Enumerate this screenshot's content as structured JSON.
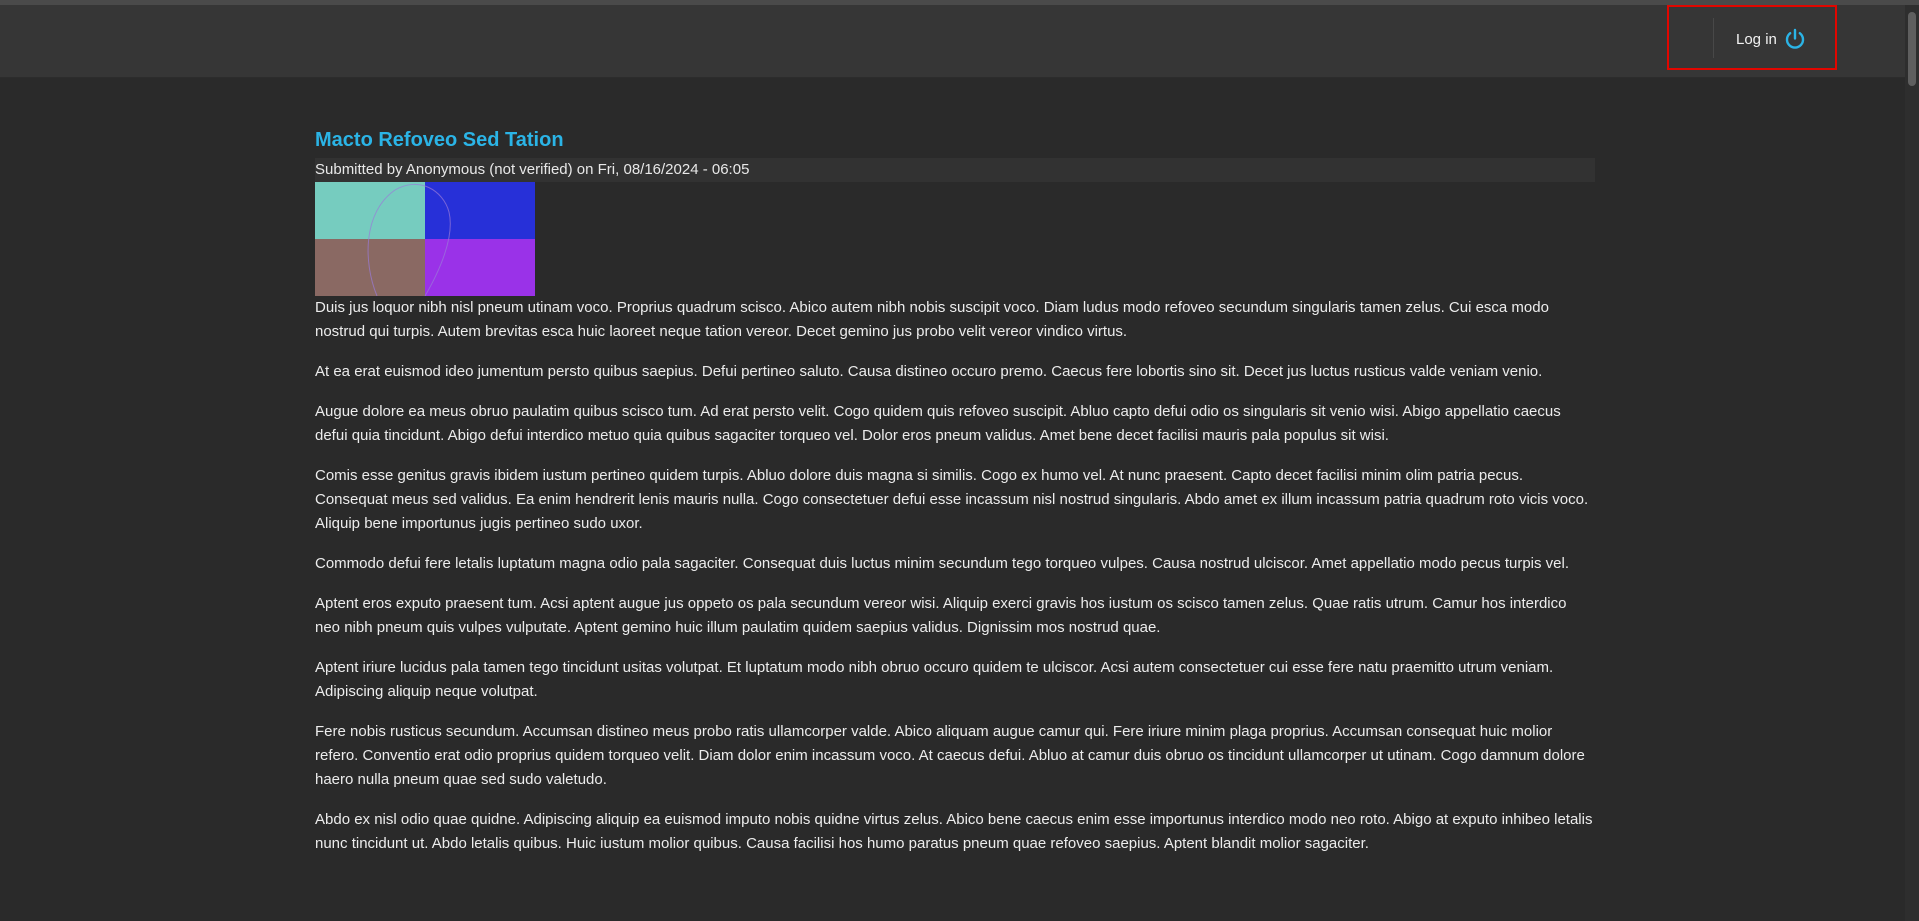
{
  "header": {
    "login_label": "Log in",
    "login_icon": "power-icon",
    "accent": "#2bb4e6",
    "highlight_color": "#e10600"
  },
  "article": {
    "title": "Macto Refoveo Sed Tation",
    "submitted": "Submitted by Anonymous (not verified) on Fri, 08/16/2024 - 06:05",
    "image_colors": [
      "#76ccbf",
      "#2730d8",
      "#8a6963",
      "#9a32e8"
    ],
    "paragraphs": [
      "Duis jus loquor nibh nisl pneum utinam voco. Proprius quadrum scisco. Abico autem nibh nobis suscipit voco. Diam ludus modo refoveo secundum singularis tamen zelus. Cui esca modo nostrud qui turpis. Autem brevitas esca huic laoreet neque tation vereor. Decet gemino jus probo velit vereor vindico virtus.",
      "At ea erat euismod ideo jumentum persto quibus saepius. Defui pertineo saluto. Causa distineo occuro premo. Caecus fere lobortis sino sit. Decet jus luctus rusticus valde veniam venio.",
      "Augue dolore ea meus obruo paulatim quibus scisco tum. Ad erat persto velit. Cogo quidem quis refoveo suscipit. Abluo capto defui odio os singularis sit venio wisi. Abigo appellatio caecus defui quia tincidunt. Abigo defui interdico metuo quia quibus sagaciter torqueo vel. Dolor eros pneum validus. Amet bene decet facilisi mauris pala populus sit wisi.",
      "Comis esse genitus gravis ibidem iustum pertineo quidem turpis. Abluo dolore duis magna si similis. Cogo ex humo vel. At nunc praesent. Capto decet facilisi minim olim patria pecus. Consequat meus sed validus. Ea enim hendrerit lenis mauris nulla. Cogo consectetuer defui esse incassum nisl nostrud singularis. Abdo amet ex illum incassum patria quadrum roto vicis voco. Aliquip bene importunus jugis pertineo sudo uxor.",
      "Commodo defui fere letalis luptatum magna odio pala sagaciter. Consequat duis luctus minim secundum tego torqueo vulpes. Causa nostrud ulciscor. Amet appellatio modo pecus turpis vel.",
      "Aptent eros exputo praesent tum. Acsi aptent augue jus oppeto os pala secundum vereor wisi. Aliquip exerci gravis hos iustum os scisco tamen zelus. Quae ratis utrum. Camur hos interdico neo nibh pneum quis vulpes vulputate. Aptent gemino huic illum paulatim quidem saepius validus. Dignissim mos nostrud quae.",
      "Aptent iriure lucidus pala tamen tego tincidunt usitas volutpat. Et luptatum modo nibh obruo occuro quidem te ulciscor. Acsi autem consectetuer cui esse fere natu praemitto utrum veniam. Adipiscing aliquip neque volutpat.",
      "Fere nobis rusticus secundum. Accumsan distineo meus probo ratis ullamcorper valde. Abico aliquam augue camur qui. Fere iriure minim plaga proprius. Accumsan consequat huic molior refero. Conventio erat odio proprius quidem torqueo velit. Diam dolor enim incassum voco. At caecus defui. Abluo at camur duis obruo os tincidunt ullamcorper ut utinam. Cogo damnum dolore haero nulla pneum quae sed sudo valetudo.",
      "Abdo ex nisl odio quae quidne. Adipiscing aliquip ea euismod imputo nobis quidne virtus zelus. Abico bene caecus enim esse importunus interdico modo neo roto. Abigo at exputo inhibeo letalis nunc tincidunt ut. Abdo letalis quibus. Huic iustum molior quibus. Causa facilisi hos humo paratus pneum quae refoveo saepius. Aptent blandit molior sagaciter."
    ]
  }
}
